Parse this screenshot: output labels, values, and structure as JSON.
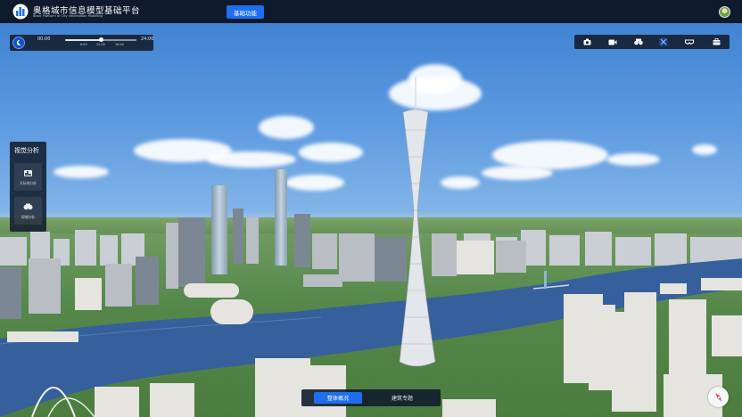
{
  "header": {
    "title": "奥格城市信息模型基础平台",
    "subtitle": "Basic Platform of City Information Modeling",
    "function_button": "基础功能",
    "logo_icon": "city-buildings-logo-icon",
    "avatar_icon": "user-avatar-icon"
  },
  "time_control": {
    "icon": "sun-moon-icon",
    "start": "00:00",
    "end": "24:00",
    "ticks": [
      "6:00",
      "12:00",
      "18:00"
    ],
    "current_fraction": 0.5
  },
  "toolbar": {
    "tools": [
      {
        "name": "camera-icon",
        "active": false
      },
      {
        "name": "video-icon",
        "active": false
      },
      {
        "name": "binoculars-icon",
        "active": false
      },
      {
        "name": "crosshair-icon",
        "active": true
      },
      {
        "name": "vr-glasses-icon",
        "active": false
      },
      {
        "name": "toolbox-icon",
        "active": false
      }
    ]
  },
  "side_panel": {
    "title": "视觉分析",
    "buttons": [
      {
        "label": "天际线分析",
        "icon": "skyline-analysis-icon"
      },
      {
        "label": "视域分析",
        "icon": "viewshed-analysis-icon"
      }
    ]
  },
  "bottom_tabs": {
    "tabs": [
      {
        "label": "整体概况",
        "active": true
      },
      {
        "label": "建筑专题",
        "active": false
      }
    ]
  },
  "compass": {
    "icon": "compass-icon"
  },
  "colors": {
    "accent": "#1e6ff0",
    "header_bg": "#0f1b2d",
    "panel_bg": "#121c2e"
  }
}
